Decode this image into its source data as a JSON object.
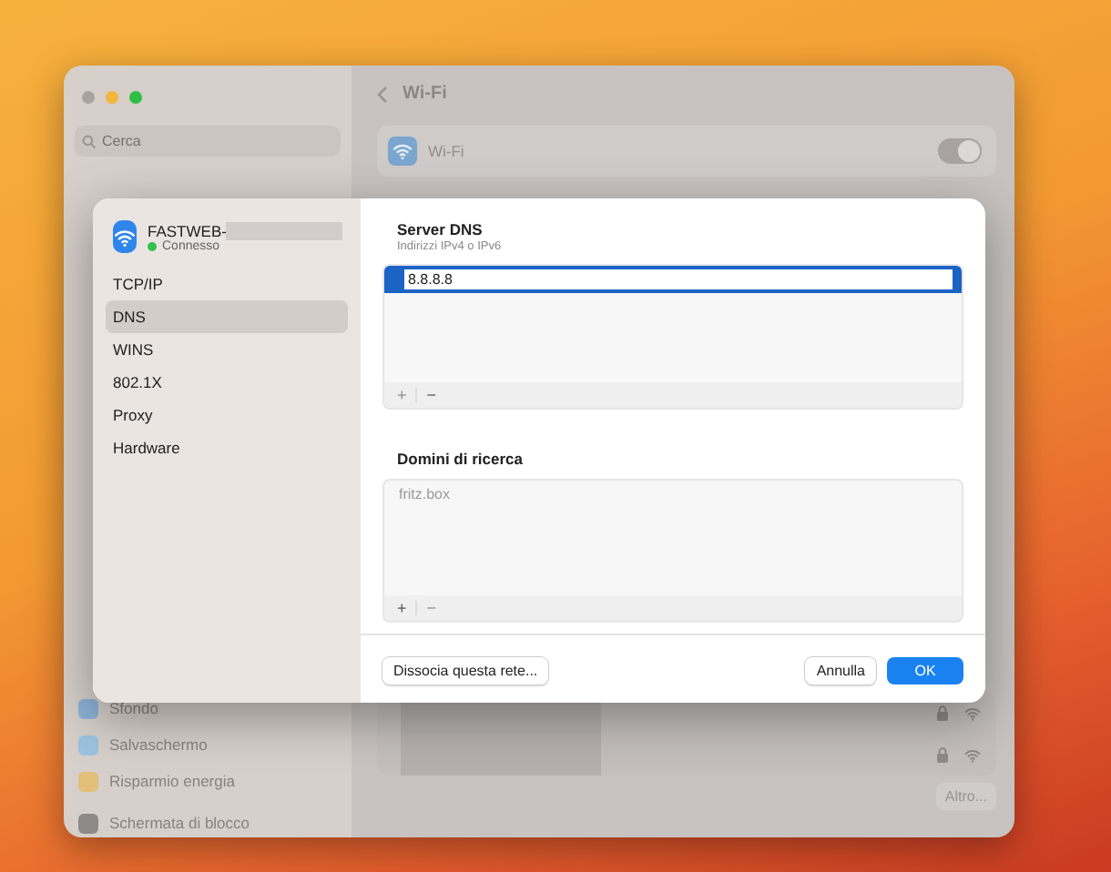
{
  "window": {
    "search": {
      "placeholder": "Cerca"
    },
    "sidebar": {
      "items": [
        {
          "label": "Sfondo",
          "color": "#8fb2d6"
        },
        {
          "label": "Salvaschermo",
          "color": "#9cc3e0"
        },
        {
          "label": "Risparmio energia",
          "color": "#e2bf7a"
        },
        {
          "label": "Schermata di blocco",
          "color": "#8e8a88"
        }
      ]
    },
    "title": "Wi-Fi",
    "wifi_row": {
      "label": "Wi-Fi",
      "on": true
    },
    "networks": [
      {
        "locked": true
      },
      {
        "locked": true
      }
    ],
    "other_button": "Altro..."
  },
  "dialog": {
    "network": {
      "name": "FASTWEB-",
      "status": "Connesso"
    },
    "tabs": [
      {
        "label": "TCP/IP",
        "selected": false
      },
      {
        "label": "DNS",
        "selected": true
      },
      {
        "label": "WINS",
        "selected": false
      },
      {
        "label": "802.1X",
        "selected": false
      },
      {
        "label": "Proxy",
        "selected": false
      },
      {
        "label": "Hardware",
        "selected": false
      }
    ],
    "dns_servers": {
      "title": "Server DNS",
      "subtitle": "Indirizzi IPv4 o IPv6",
      "entries": [
        {
          "value": "8.8.8.8",
          "selected": true
        }
      ],
      "controls": [
        {
          "label": "+",
          "disabled": true
        },
        {
          "label": "−",
          "disabled": false
        }
      ]
    },
    "search_domains": {
      "title": "Domini di ricerca",
      "entries": [
        {
          "value": "fritz.box",
          "selected": false
        }
      ],
      "controls": [
        {
          "label": "+",
          "disabled": false
        },
        {
          "label": "−",
          "disabled": true
        }
      ]
    },
    "buttons": [
      {
        "label": "Dissocia questa rete...",
        "kind": "secondary"
      },
      {
        "label": "Annulla",
        "kind": "cancel"
      },
      {
        "label": "OK",
        "kind": "primary"
      }
    ]
  }
}
